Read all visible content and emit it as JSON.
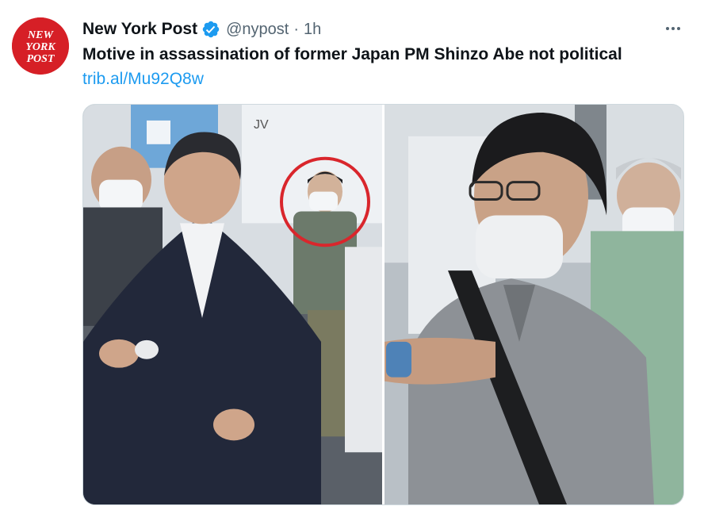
{
  "tweet": {
    "author": {
      "display_name": "New York Post",
      "handle": "@nypost",
      "verified": true,
      "avatar_text": "NEW YORK POST",
      "avatar_color": "#d61f26"
    },
    "separator": "·",
    "time": "1h",
    "text": "Motive in assassination of former Japan PM Shinzo Abe not political",
    "link": "trib.al/Mu92Q8w",
    "menu_icon": "more-horizontal-icon",
    "media": {
      "photo_count": 2,
      "photos": [
        {
          "subject": "man-in-suit-holding-microphone-with-circled-suspect"
        },
        {
          "subject": "man-with-glasses-and-mask-in-gray-polo"
        }
      ]
    }
  },
  "colors": {
    "text_primary": "#0f1419",
    "text_secondary": "#536471",
    "link": "#1d9bf0",
    "verified": "#1d9bf0",
    "border": "#cfd9de"
  }
}
